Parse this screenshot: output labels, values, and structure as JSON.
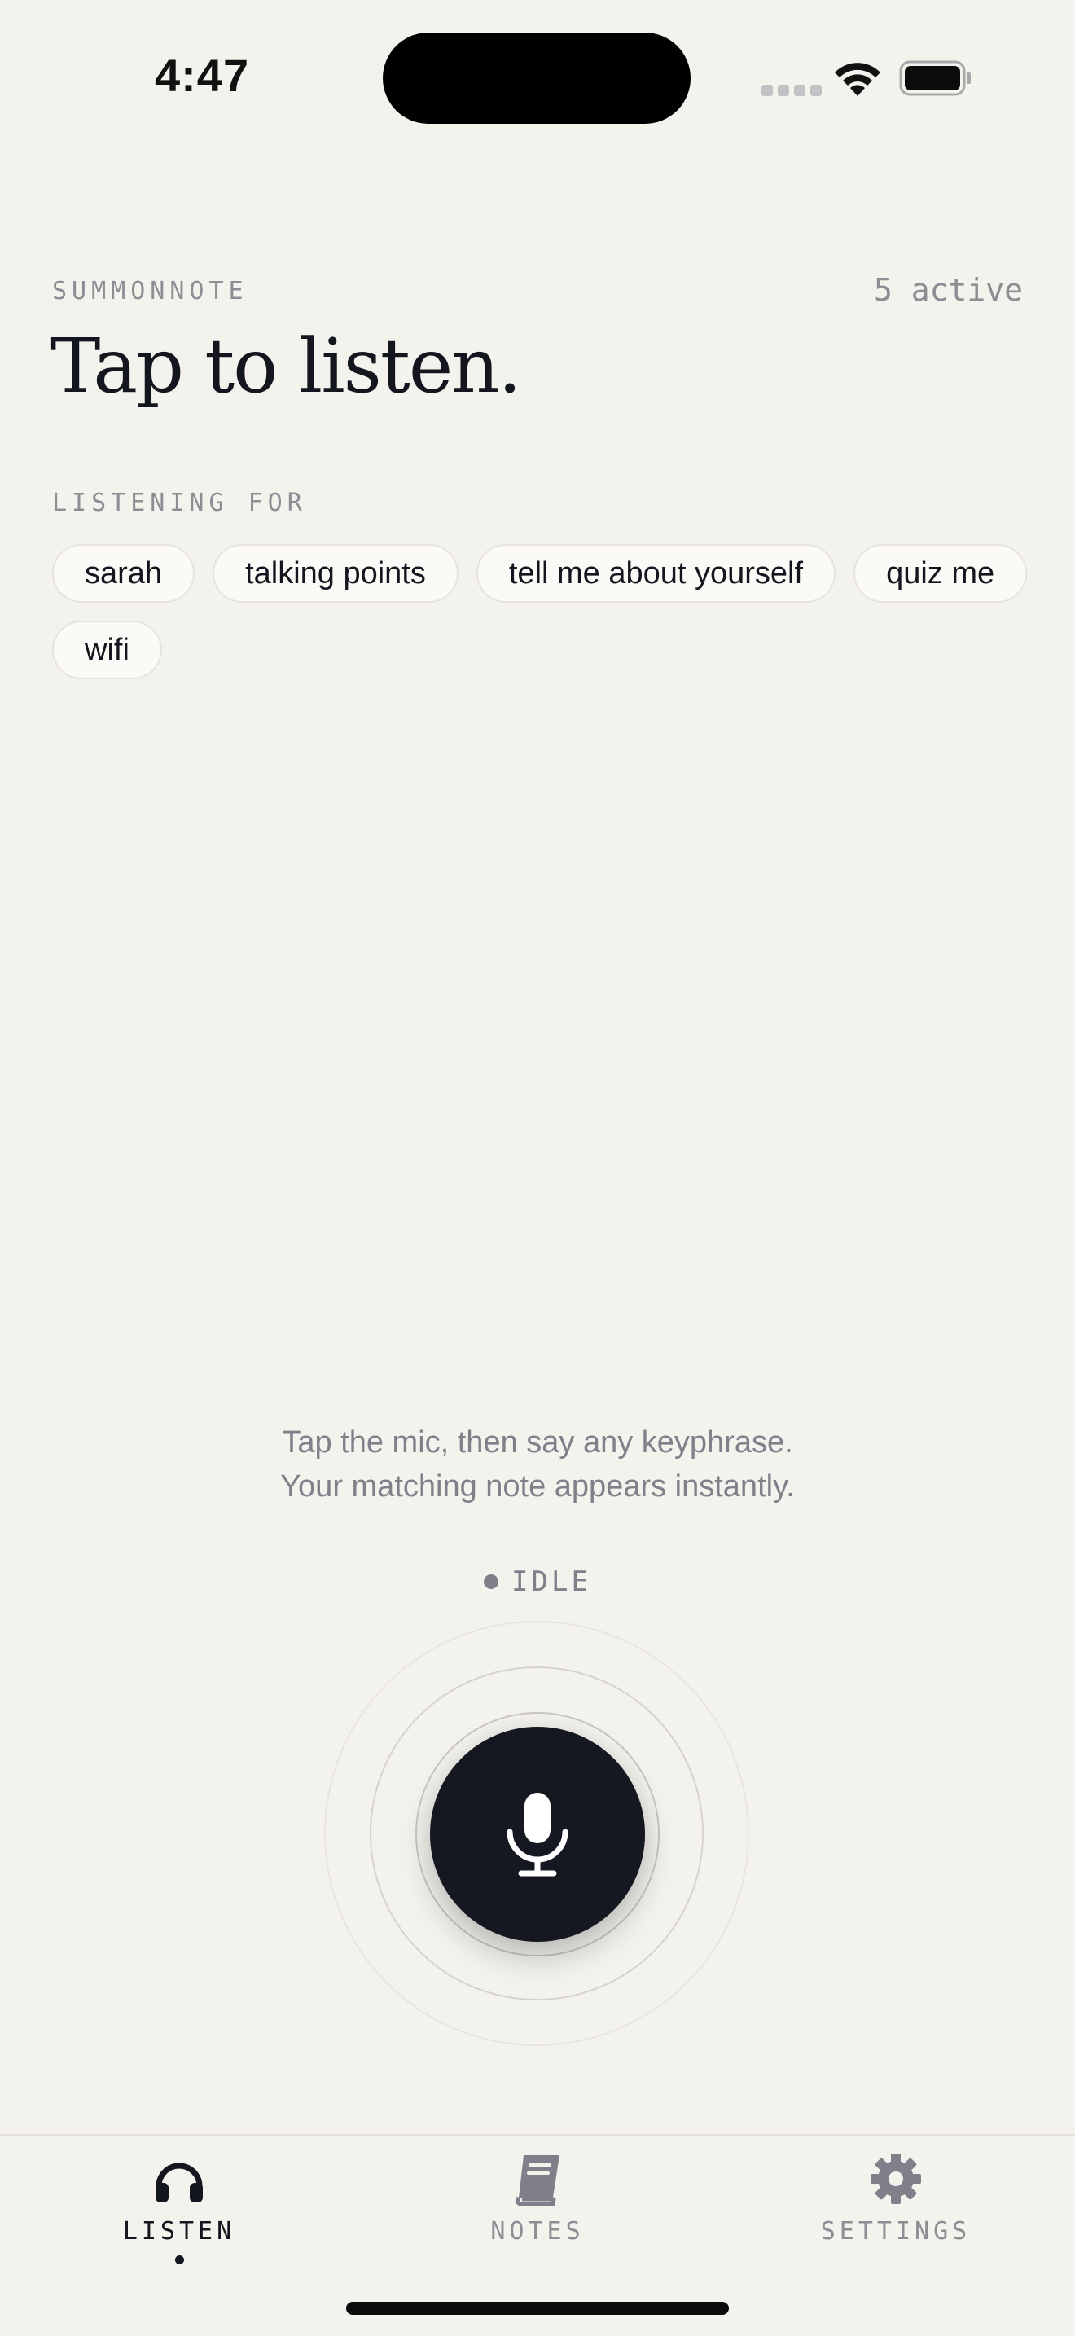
{
  "status_bar": {
    "time": "4:47"
  },
  "header": {
    "app_name": "SUMMONNOTE",
    "active_count": "5 active",
    "title": "Tap to listen."
  },
  "listening": {
    "section_label": "LISTENING FOR",
    "keyphrases": [
      "sarah",
      "talking points",
      "tell me about yourself",
      "quiz me",
      "wifi"
    ]
  },
  "instructions": {
    "line1": "Tap the mic, then say any keyphrase.",
    "line2": "Your matching note appears instantly."
  },
  "state": {
    "label": "IDLE"
  },
  "mic": {
    "icon": "microphone-icon"
  },
  "tabs": [
    {
      "label": "LISTEN",
      "icon": "headphones-icon",
      "active": true
    },
    {
      "label": "NOTES",
      "icon": "book-icon",
      "active": false
    },
    {
      "label": "SETTINGS",
      "icon": "gear-icon",
      "active": false
    }
  ],
  "colors": {
    "background": "#f4f2ed",
    "ink": "#14161f",
    "muted": "#8d8d93",
    "mic_button": "#151821"
  }
}
